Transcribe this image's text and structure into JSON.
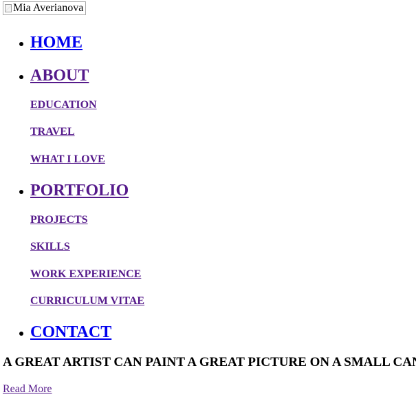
{
  "logo": {
    "alt_text": "Mia Averianova",
    "icon": "broken-image-icon"
  },
  "nav": {
    "home": "HOME",
    "about": "ABOUT",
    "about_children": [
      "EDUCATION",
      "TRAVEL",
      "WHAT I LOVE"
    ],
    "portfolio": "PORTFOLIO",
    "portfolio_children": [
      "PROJECTS",
      "SKILLS",
      "WORK EXPERIENCE",
      "CURRICULUM VITAE"
    ],
    "contact": "CONTACT"
  },
  "hero": {
    "heading": "A GREAT ARTIST CAN PAINT A GREAT PICTURE ON A SMALL CAN",
    "cta": "Read More"
  },
  "colors": {
    "link_unvisited": "#0000ee",
    "link_visited": "#551a8b",
    "text": "#000000",
    "background": "#ffffff"
  }
}
